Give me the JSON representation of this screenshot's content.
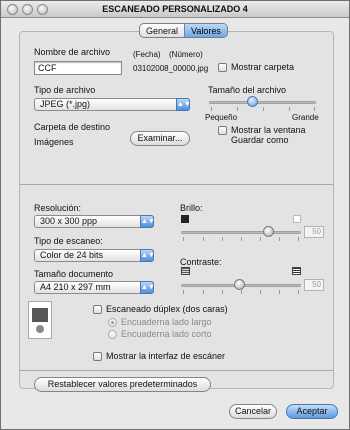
{
  "window": {
    "title": "ESCANEADO PERSONALIZADO 4"
  },
  "tabs": [
    {
      "label": "General",
      "selected": false
    },
    {
      "label": "Valores",
      "selected": true
    }
  ],
  "file_name": {
    "label": "Nombre de archivo",
    "value": "CCF",
    "date_label": "(Fecha)",
    "number_label": "(Número)",
    "generated_name": "03102008_00000.jpg",
    "show_folder_label": "Mostrar carpeta",
    "show_folder_checked": false
  },
  "file_type": {
    "label": "Tipo de archivo",
    "value": "JPEG (*.jpg)"
  },
  "file_size": {
    "label": "Tamaño del archivo",
    "min_label": "Pequeño",
    "max_label": "Grande",
    "level_percent": 40
  },
  "destination": {
    "label": "Carpeta de destino",
    "value": "Imágenes",
    "browse_label": "Examinar...",
    "show_window_label_line1": "Mostrar la ventana",
    "show_window_label_line2": "Guardar como",
    "show_window_checked": false
  },
  "resolution": {
    "label": "Resolución:",
    "value": "300 x 300 ppp"
  },
  "scan_type": {
    "label": "Tipo de escaneo:",
    "value": "Color de 24 bits"
  },
  "doc_size": {
    "label": "Tamaño documento",
    "value": "A4  210 x 297 mm"
  },
  "brightness": {
    "label": "Brillo:",
    "value": "50"
  },
  "contrast": {
    "label": "Contraste:",
    "value": "50"
  },
  "duplex": {
    "label": "Escaneado dúplex (dos caras)",
    "checked": false,
    "option_long": "Encuaderna lado largo",
    "option_short": "Encuaderna lado corto",
    "selected": "long"
  },
  "show_scanner_ui": {
    "label": "Mostrar la interfaz de escáner",
    "checked": false
  },
  "footer": {
    "reset_label": "Restablecer valores predeterminados",
    "cancel_label": "Cancelar",
    "accept_label": "Aceptar"
  },
  "colors": {
    "accent": "#5d9be3",
    "window_bg": "#e8e8e8"
  },
  "icons": [
    "close-icon",
    "minimize-icon",
    "zoom-icon",
    "brightness-dark-icon",
    "brightness-light-icon",
    "contrast-low-icon",
    "contrast-high-icon",
    "document-preview-icon"
  ]
}
